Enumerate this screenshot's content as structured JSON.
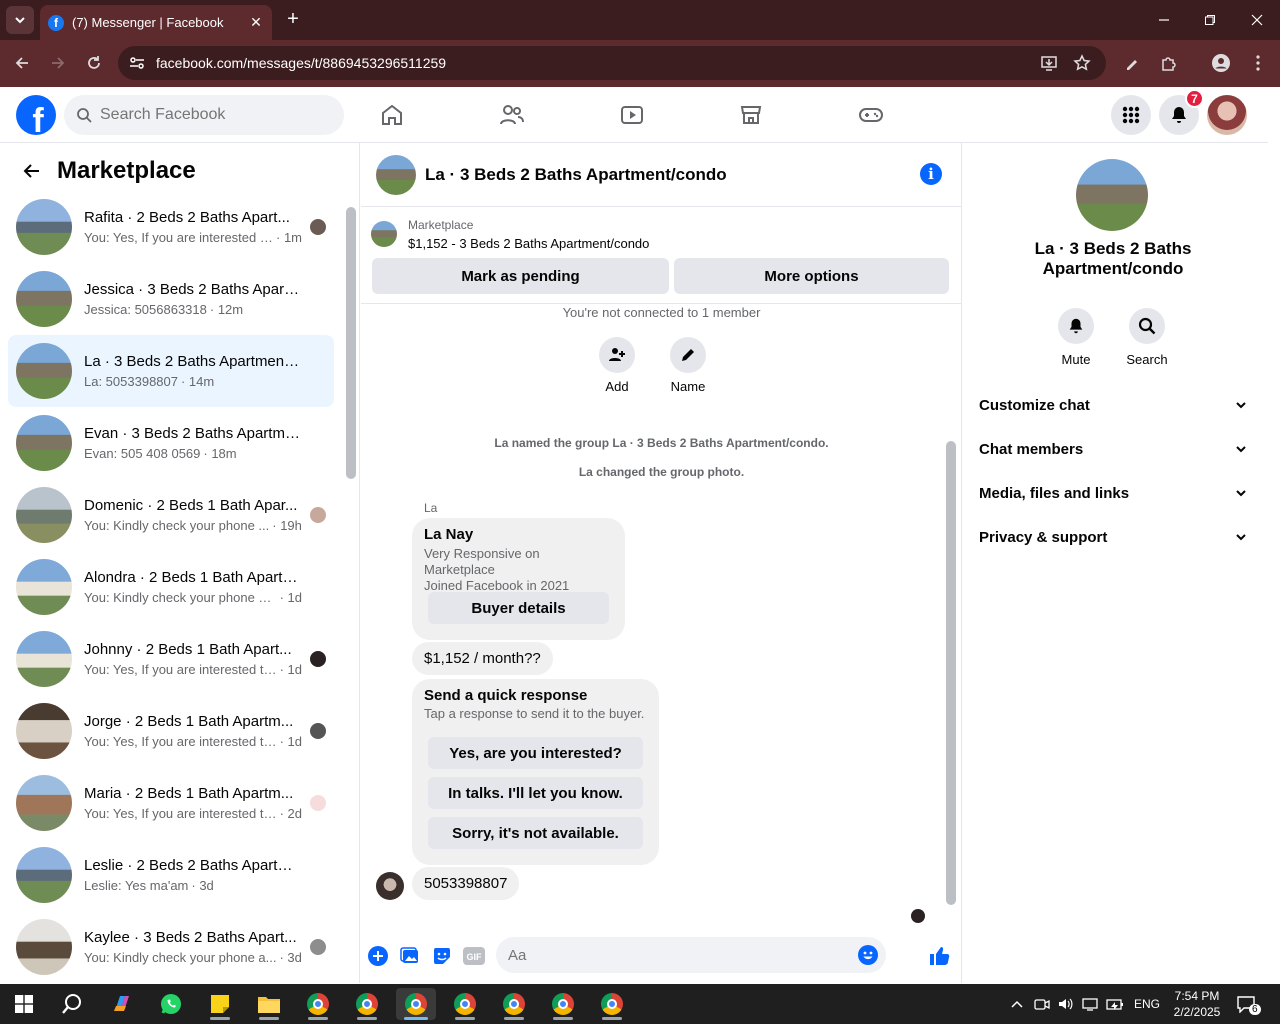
{
  "browser": {
    "tab_title": "(7) Messenger | Facebook",
    "url": "facebook.com/messages/t/8869453296511259"
  },
  "fb": {
    "search_placeholder": "Search Facebook",
    "notifications_count": "7"
  },
  "left": {
    "title": "Marketplace",
    "conversations": [
      {
        "name": "Rafita · 2 Beds 2 Baths Apart...",
        "snippet": "You: Yes, If you are interested t...",
        "time": "· 1m"
      },
      {
        "name": "Jessica · 3 Beds 2 Baths Apartm...",
        "snippet": "Jessica: 5056863318",
        "time": "· 12m"
      },
      {
        "name": "La · 3 Beds 2 Baths Apartment/c...",
        "snippet": "La: 5053398807",
        "time": "· 14m"
      },
      {
        "name": "Evan · 3 Beds 2 Baths Apartmen...",
        "snippet": "Evan: 505 408 0569",
        "time": "· 18m"
      },
      {
        "name": "Domenic · 2 Beds 1 Bath Apar...",
        "snippet": "You: Kindly check your phone ...",
        "time": "· 19h"
      },
      {
        "name": "Alondra · 2 Beds 1 Bath Apartm...",
        "snippet": "You: Kindly check your phone and I...",
        "time": "· 1d"
      },
      {
        "name": "Johnny · 2 Beds 1 Bath Apart...",
        "snippet": "You: Yes, If you are interested th...",
        "time": "· 1d"
      },
      {
        "name": "Jorge · 2 Beds 1 Bath Apartm...",
        "snippet": "You: Yes, If you are interested th...",
        "time": "· 1d"
      },
      {
        "name": "Maria · 2 Beds 1 Bath Apartm...",
        "snippet": "You: Yes, If you are interested th...",
        "time": "· 2d"
      },
      {
        "name": "Leslie · 2 Beds 2 Baths Apartme...",
        "snippet": "Leslie: Yes ma'am",
        "time": "· 3d"
      },
      {
        "name": "Kaylee · 3 Beds 2 Baths Apart...",
        "snippet": "You: Kindly check your phone a...",
        "time": "· 3d"
      }
    ]
  },
  "chat": {
    "title": "La · 3 Beds 2 Baths Apartment/condo",
    "listing_source": "Marketplace",
    "listing_price": "$1,152 - 3 Beds 2 Baths Apartment/condo",
    "mark_pending": "Mark as pending",
    "more_options": "More options",
    "not_connected": "You're not connected to 1 member",
    "add_label": "Add",
    "name_label": "Name",
    "sys_named": "La named the group La · 3 Beds 2 Baths Apartment/condo.",
    "sys_photo": "La changed the group photo.",
    "sender": "La",
    "card_name": "La Nay",
    "card_line1": "Very Responsive on Marketplace",
    "card_line2": "Joined Facebook in 2021",
    "buyer_details": "Buyer details",
    "msg_price": "$1,152 / month??",
    "quick_title": "Send a quick response",
    "quick_sub": "Tap a response to send it to the buyer.",
    "quick_1": "Yes, are you interested?",
    "quick_2": "In talks. I'll let you know.",
    "quick_3": "Sorry, it's not available.",
    "msg_phone": "5053398807",
    "composer_placeholder": "Aa"
  },
  "right": {
    "title": "La · 3 Beds 2 Baths Apartment/condo",
    "mute": "Mute",
    "search": "Search",
    "sections": [
      "Customize chat",
      "Chat members",
      "Media, files and links",
      "Privacy & support"
    ]
  },
  "taskbar": {
    "lang": "ENG",
    "time": "7:54 PM",
    "date": "2/2/2025",
    "notif_count": "6"
  }
}
